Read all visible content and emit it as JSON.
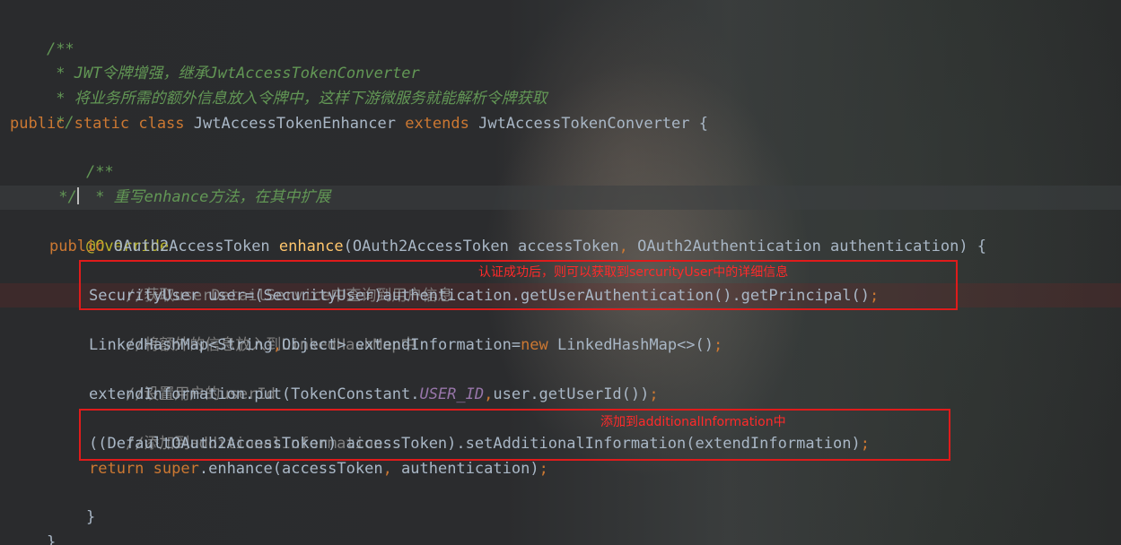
{
  "code": {
    "doc_open": "/**",
    "doc_line1": " * JWT令牌增强，继承JwtAccessTokenConverter",
    "doc_line2": " * 将业务所需的额外信息放入令牌中，这样下游微服务就能解析令牌获取",
    "doc_close": " */",
    "class_kw_public": "public",
    "class_kw_static": "static",
    "class_kw_class": "class",
    "class_name": "JwtAccessTokenEnhancer",
    "class_kw_extends": "extends",
    "class_super": "JwtAccessTokenConverter {",
    "m_doc_open": "/**",
    "m_doc_line1": " * 重写enhance方法，在其中扩展",
    "m_doc_close": " */",
    "annotation": "@Override",
    "sig_public": "public",
    "sig_return": "OAuth2AccessToken",
    "sig_name": "enhance",
    "sig_params_a": "(OAuth2AccessToken accessToken",
    "sig_comma": ",",
    "sig_params_b": " OAuth2Authentication authentication) {",
    "c_get_user": "//获取userDetailService中查询到用户信息",
    "l_security_user": "SecurityUser user=(SecurityUser)authentication.getUserAuthentication().getPrincipal()",
    "semi": ";",
    "c_put_map": "//将额外的信息放入到LinkedHashMap中",
    "l_map_a": "LinkedHashMap<String",
    "l_map_comma": ",",
    "l_map_b": "Object> extendInformation=",
    "kw_new": "new",
    "l_map_c": " LinkedHashMap<>()",
    "c_set_userid": "//设置用户的userId",
    "l_put_a": "extendInformation.put(TokenConstant.",
    "l_put_const": "USER_ID",
    "l_put_comma": ",",
    "l_put_b": "user.getUserId())",
    "c_add_info": "//添加到additionalInformation",
    "l_set_info": "((DefaultOAuth2AccessToken) accessToken).setAdditionalInformation(extendInformation)",
    "kw_return": "return",
    "kw_super": "super",
    "l_return_a": ".enhance(accessToken",
    "l_return_comma": ",",
    "l_return_b": " authentication)",
    "brace_method": "}",
    "brace_class": "}"
  },
  "annotations": {
    "note1": "认证成功后，则可以获取到sercurityUser中的详细信息",
    "note2": "添加到additionalInformation中",
    "box_color": "#e01b1b"
  },
  "theme": {
    "comment": "#629755",
    "line_comment": "#808080",
    "keyword": "#cc7832",
    "annotation": "#bbb529",
    "method": "#ffc66d",
    "static_field": "#9876aa",
    "default_text": "#a9b7c6"
  }
}
